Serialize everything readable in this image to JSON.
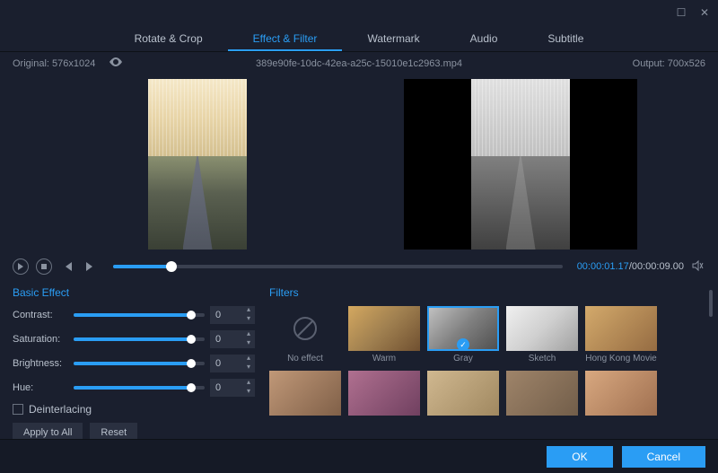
{
  "titlebar": {
    "max": "☐",
    "close": "✕"
  },
  "tabs": [
    "Rotate & Crop",
    "Effect & Filter",
    "Watermark",
    "Audio",
    "Subtitle"
  ],
  "active_tab": 1,
  "info": {
    "original_label": "Original: 576x1024",
    "filename": "389e90fe-10dc-42ea-a25c-15010e1c2963.mp4",
    "output_label": "Output: 700x526"
  },
  "timeline": {
    "current": "00:00:01.17",
    "separator": "/",
    "total": "00:00:09.00"
  },
  "basic_effect": {
    "title": "Basic Effect",
    "rows": [
      {
        "label": "Contrast:",
        "value": "0"
      },
      {
        "label": "Saturation:",
        "value": "0"
      },
      {
        "label": "Brightness:",
        "value": "0"
      },
      {
        "label": "Hue:",
        "value": "0"
      }
    ],
    "deinterlacing": "Deinterlacing",
    "apply": "Apply to All",
    "reset": "Reset"
  },
  "filters": {
    "title": "Filters",
    "items": [
      {
        "label": "No effect",
        "class": "noeffect",
        "selected": false
      },
      {
        "label": "Warm",
        "class": "warm",
        "selected": false
      },
      {
        "label": "Gray",
        "class": "gray-f",
        "selected": true
      },
      {
        "label": "Sketch",
        "class": "sketch",
        "selected": false
      },
      {
        "label": "Hong Kong Movie",
        "class": "hk",
        "selected": false
      },
      {
        "label": "",
        "class": "f1",
        "selected": false
      },
      {
        "label": "",
        "class": "f2",
        "selected": false
      },
      {
        "label": "",
        "class": "f3",
        "selected": false
      },
      {
        "label": "",
        "class": "f4",
        "selected": false
      },
      {
        "label": "",
        "class": "f5",
        "selected": false
      }
    ]
  },
  "footer": {
    "ok": "OK",
    "cancel": "Cancel"
  }
}
